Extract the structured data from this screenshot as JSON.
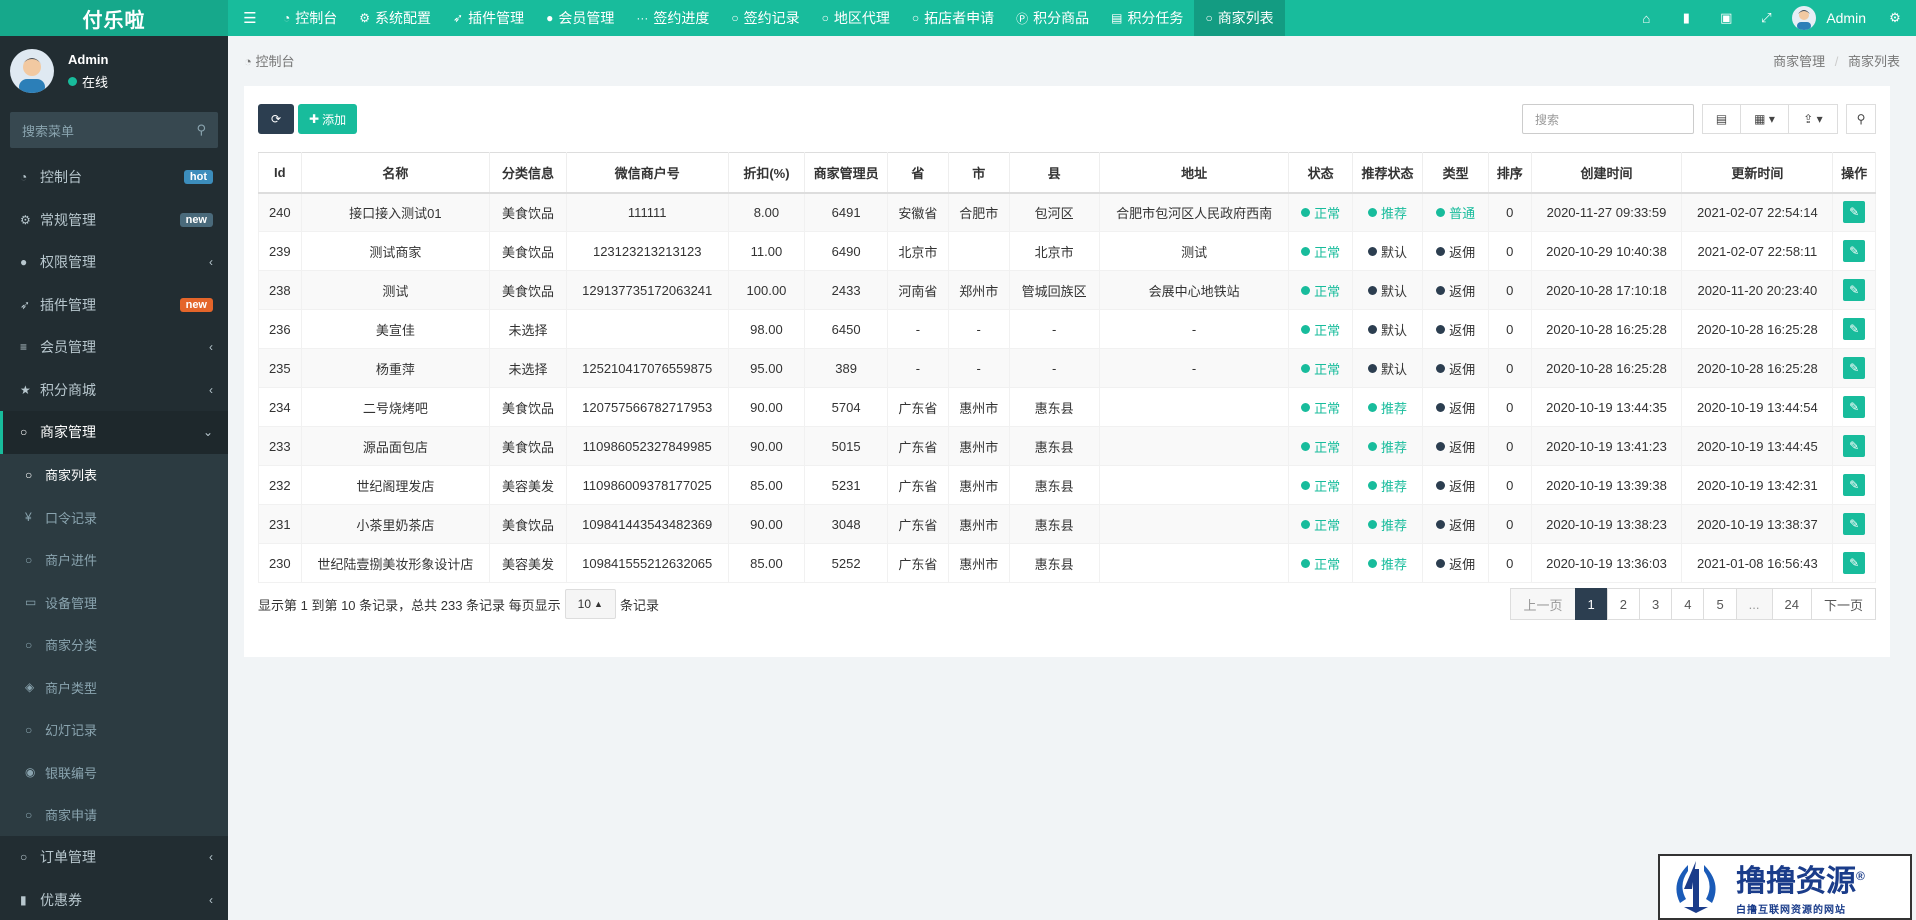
{
  "app": {
    "logo_text": "付乐啦"
  },
  "topnav": {
    "items": [
      {
        "icon": "dashboard-icon",
        "label": "控制台"
      },
      {
        "icon": "cogs-icon",
        "label": "系统配置"
      },
      {
        "icon": "rocket-icon",
        "label": "插件管理"
      },
      {
        "icon": "user-icon",
        "label": "会员管理"
      },
      {
        "icon": "ellipsis-icon",
        "label": "签约进度"
      },
      {
        "icon": "circle-icon",
        "label": "签约记录"
      },
      {
        "icon": "circle-icon",
        "label": "地区代理"
      },
      {
        "icon": "circle-icon",
        "label": "拓店者申请"
      },
      {
        "icon": "points-icon",
        "label": "积分商品"
      },
      {
        "icon": "list-icon",
        "label": "积分任务"
      },
      {
        "icon": "circle-icon",
        "label": "商家列表"
      }
    ],
    "user_name": "Admin"
  },
  "sidebar": {
    "user_name": "Admin",
    "user_status": "在线",
    "search_placeholder": "搜索菜单",
    "items": [
      {
        "label": "控制台",
        "badge": "hot",
        "badge_color": "#3c8dbc"
      },
      {
        "label": "常规管理",
        "badge": "new",
        "badge_color": "#4a6a7b"
      },
      {
        "label": "权限管理"
      },
      {
        "label": "插件管理",
        "badge": "new",
        "badge_color": "#e4652a"
      },
      {
        "label": "会员管理"
      },
      {
        "label": "积分商城"
      },
      {
        "label": "商家管理"
      }
    ],
    "sub_items": [
      {
        "label": "商家列表"
      },
      {
        "label": "口令记录"
      },
      {
        "label": "商户进件"
      },
      {
        "label": "设备管理"
      },
      {
        "label": "商家分类"
      },
      {
        "label": "商户类型"
      },
      {
        "label": "幻灯记录"
      },
      {
        "label": "银联编号"
      },
      {
        "label": "商家申请"
      }
    ],
    "bottom_items": [
      {
        "label": "订单管理"
      },
      {
        "label": "优惠券"
      }
    ]
  },
  "breadcrumb": {
    "left": "控制台",
    "right_1": "商家管理",
    "right_2": "商家列表",
    "separator": "/"
  },
  "toolbar": {
    "add_label": "添加",
    "search_placeholder": "搜索"
  },
  "table": {
    "columns": [
      "Id",
      "名称",
      "分类信息",
      "微信商户号",
      "折扣(%)",
      "商家管理员",
      "省",
      "市",
      "县",
      "地址",
      "状态",
      "推荐状态",
      "类型",
      "排序",
      "创建时间",
      "更新时间",
      "操作"
    ],
    "rows": [
      [
        "240",
        "接口接入测试01",
        "美食饮品",
        "111111",
        "8.00",
        "6491",
        "安徽省",
        "合肥市",
        "包河区",
        "合肥市包河区人民政府西南",
        "正常",
        "推荐",
        "普通",
        "0",
        "2020-11-27 09:33:59",
        "2021-02-07 22:54:14"
      ],
      [
        "239",
        "测试商家",
        "美食饮品",
        "123123213213123",
        "11.00",
        "6490",
        "北京市",
        "",
        "北京市",
        "测试",
        "正常",
        "默认",
        "返佣",
        "0",
        "2020-10-29 10:40:38",
        "2021-02-07 22:58:11"
      ],
      [
        "238",
        "测试",
        "美食饮品",
        "129137735172063241",
        "100.00",
        "2433",
        "河南省",
        "郑州市",
        "管城回族区",
        "会展中心地铁站",
        "正常",
        "默认",
        "返佣",
        "0",
        "2020-10-28 17:10:18",
        "2020-11-20 20:23:40"
      ],
      [
        "236",
        "美宣佳",
        "未选择",
        "",
        "98.00",
        "6450",
        "-",
        "-",
        "-",
        "-",
        "正常",
        "默认",
        "返佣",
        "0",
        "2020-10-28 16:25:28",
        "2020-10-28 16:25:28"
      ],
      [
        "235",
        "杨重萍",
        "未选择",
        "125210417076559875",
        "95.00",
        "389",
        "-",
        "-",
        "-",
        "-",
        "正常",
        "默认",
        "返佣",
        "0",
        "2020-10-28 16:25:28",
        "2020-10-28 16:25:28"
      ],
      [
        "234",
        "二号烧烤吧",
        "美食饮品",
        "120757566782717953",
        "90.00",
        "5704",
        "广东省",
        "惠州市",
        "惠东县",
        "",
        "正常",
        "推荐",
        "返佣",
        "0",
        "2020-10-19 13:44:35",
        "2020-10-19 13:44:54"
      ],
      [
        "233",
        "源品面包店",
        "美食饮品",
        "110986052327849985",
        "90.00",
        "5015",
        "广东省",
        "惠州市",
        "惠东县",
        "",
        "正常",
        "推荐",
        "返佣",
        "0",
        "2020-10-19 13:41:23",
        "2020-10-19 13:44:45"
      ],
      [
        "232",
        "世纪阁理发店",
        "美容美发",
        "110986009378177025",
        "85.00",
        "5231",
        "广东省",
        "惠州市",
        "惠东县",
        "",
        "正常",
        "推荐",
        "返佣",
        "0",
        "2020-10-19 13:39:38",
        "2020-10-19 13:42:31"
      ],
      [
        "231",
        "小茶里奶茶店",
        "美食饮品",
        "109841443543482369",
        "90.00",
        "3048",
        "广东省",
        "惠州市",
        "惠东县",
        "",
        "正常",
        "推荐",
        "返佣",
        "0",
        "2020-10-19 13:38:23",
        "2020-10-19 13:38:37"
      ],
      [
        "230",
        "世纪陆壹捌美妆形象设计店",
        "美容美发",
        "109841555212632065",
        "85.00",
        "5252",
        "广东省",
        "惠州市",
        "惠东县",
        "",
        "正常",
        "推荐",
        "返佣",
        "0",
        "2020-10-19 13:36:03",
        "2021-01-08 16:56:43"
      ]
    ]
  },
  "pagination": {
    "info_prefix": "显示第 1 到第 10 条记录，总共 233 条记录 每页显示",
    "page_size": "10",
    "info_suffix": "条记录",
    "prev": "上一页",
    "next": "下一页",
    "pages": [
      "1",
      "2",
      "3",
      "4",
      "5",
      "...",
      "24"
    ]
  },
  "watermark": {
    "title": "撸撸资源",
    "registered": "®",
    "subtitle": "白撸互联网资源的网站"
  },
  "colors": {
    "primary": "#18bc9c",
    "dark": "#2c3e50",
    "sidebar_bg": "#222d32"
  }
}
